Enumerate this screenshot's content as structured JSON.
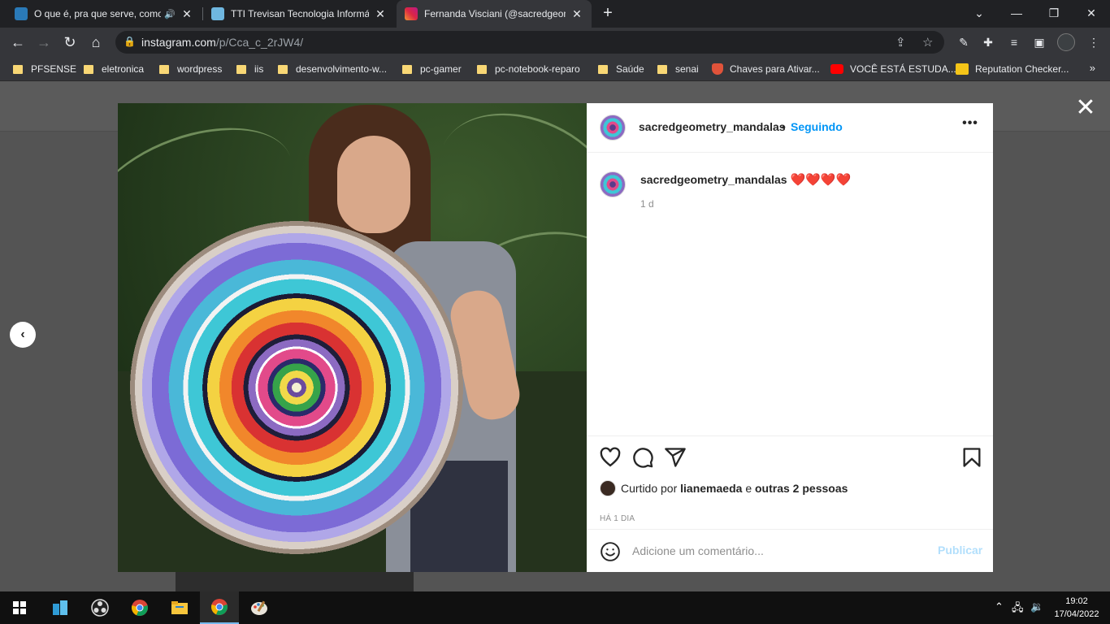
{
  "browser": {
    "tabs": [
      {
        "title": "O que é, pra que serve, como",
        "audio": "🔊",
        "close": "✕",
        "favicon_color": "#2a7ab8"
      },
      {
        "title": "TTI Trevisan Tecnologia Informáti",
        "close": "✕",
        "favicon_color": "#6fb7e0"
      },
      {
        "title": "Fernanda Visciani (@sacredgeom",
        "close": "✕",
        "favicon_color": "#d6249f"
      }
    ],
    "new_tab": "+",
    "window_controls": {
      "minimize": "—",
      "restore": "❐",
      "close": "✕",
      "tabsearch": "⌄"
    },
    "url_host": "instagram.com",
    "url_path": "/p/Cca_c_2rJW4/",
    "nav": {
      "back": "←",
      "forward": "→",
      "reload": "↻",
      "home": "⌂",
      "lock": "🔒",
      "share": "⇪",
      "star": "☆"
    },
    "extensions": {
      "pen": "✎",
      "puzzle": "✚",
      "media": "≡",
      "sidepanel": "▣",
      "menu": "⋮"
    }
  },
  "bookmarks": [
    {
      "label": "PFSENSE",
      "type": "folder"
    },
    {
      "label": "eletronica",
      "type": "folder"
    },
    {
      "label": "wordpress",
      "type": "folder"
    },
    {
      "label": "iis",
      "type": "folder"
    },
    {
      "label": "desenvolvimento-w...",
      "type": "folder"
    },
    {
      "label": "pc-gamer",
      "type": "folder"
    },
    {
      "label": "pc-notebook-reparo",
      "type": "folder"
    },
    {
      "label": "Saúde",
      "type": "folder"
    },
    {
      "label": "senai",
      "type": "folder"
    },
    {
      "label": "Chaves para Ativar...",
      "type": "site",
      "color": "#e0533a"
    },
    {
      "label": "VOCÊ ESTÁ ESTUDA...",
      "type": "site",
      "color": "#ff0000"
    },
    {
      "label": "Reputation Checker...",
      "type": "site",
      "color": "#f5c518"
    }
  ],
  "bookmarks_more": "»",
  "modal": {
    "close": "✕",
    "prev": "‹",
    "post": {
      "username": "sacredgeometry_mandalas",
      "separator": "•",
      "follow_status": "Seguindo",
      "more_options": "•••",
      "caption_user": "sacredgeometry_mandalas",
      "caption_hearts": "❤️❤️❤️❤️",
      "caption_time": "1 d",
      "liked_by_prefix": "Curtido por",
      "liked_by_user": "lianemaeda",
      "liked_by_connector": "e",
      "liked_by_others": "outras 2 pessoas",
      "posted_ago": "HÁ 1 DIA",
      "comment_placeholder": "Adicione um comentário...",
      "publish_label": "Publicar"
    }
  },
  "taskbar": {
    "time": "19:02",
    "date": "17/04/2022",
    "tray_up": "⌃",
    "tray_network": "🖧",
    "tray_volume": "🔉"
  },
  "colors": {
    "accent_blue": "#0095f6",
    "publish_disabled": "#b2dffc",
    "browser_dark": "#202124",
    "toolbar": "#35363a"
  }
}
